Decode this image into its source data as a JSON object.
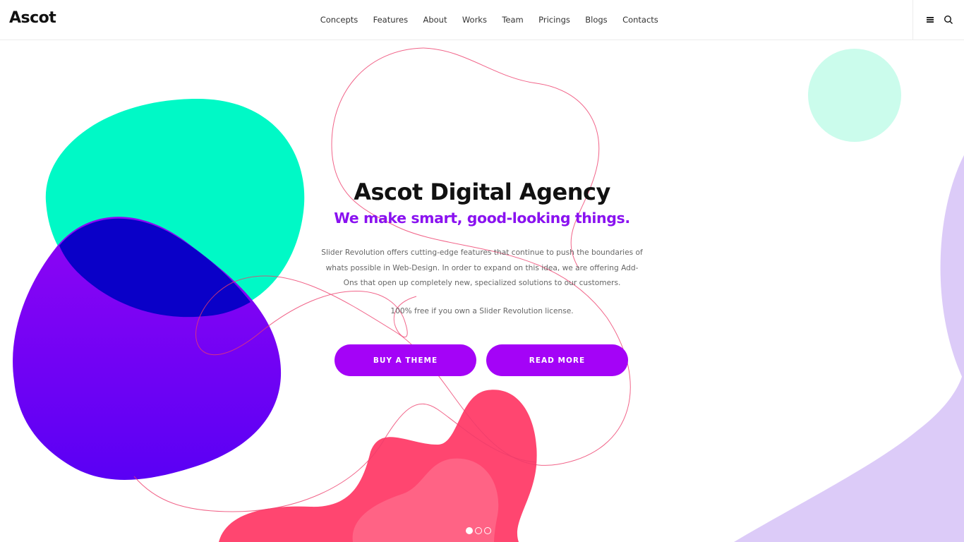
{
  "header": {
    "logo": "Ascot",
    "nav": [
      {
        "label": "Concepts"
      },
      {
        "label": "Features"
      },
      {
        "label": "About"
      },
      {
        "label": "Works"
      },
      {
        "label": "Team"
      },
      {
        "label": "Pricings"
      },
      {
        "label": "Blogs"
      },
      {
        "label": "Contacts"
      }
    ],
    "icons": [
      "menu-icon",
      "search-icon"
    ]
  },
  "hero": {
    "title": "Ascot Digital Agency",
    "subtitle": "We make smart, good-looking things.",
    "description": "Slider Revolution offers cutting-edge features that continue to push the boundaries of whats possible in Web-Design. In order to expand on this idea, we are offering Add-Ons that open up completely new, specialized solutions to our customers.",
    "note": "100% free if you own a Slider Revolution license.",
    "primary_button": "BUY A THEME",
    "secondary_button": "READ MORE"
  },
  "slider": {
    "slide_count": 3,
    "active_slide": 1
  },
  "colors": {
    "accent": "#a403f7",
    "subtitle": "#8a12f0",
    "green_blob": "#00f9c6",
    "purple_blob": "#6a00f2",
    "pink_blob": "#ff4670",
    "lavender": "#dccbf8",
    "mint_circle": "#cbfcec",
    "outline": "#ee3d6b"
  }
}
